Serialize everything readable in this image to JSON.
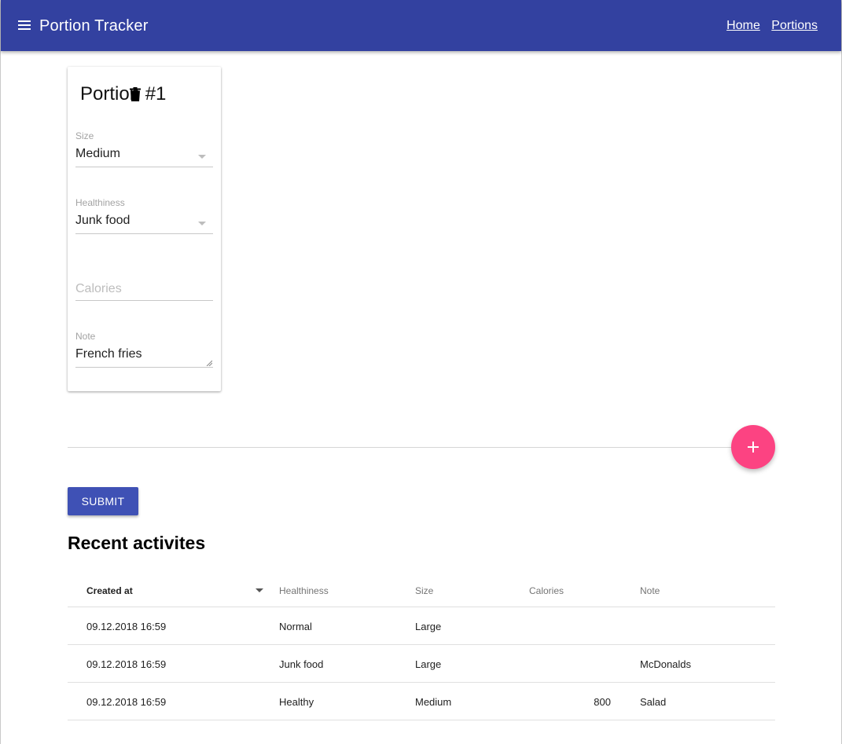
{
  "app": {
    "title": "Portion Tracker",
    "nav": {
      "home": "Home",
      "portions": "Portions"
    },
    "colors": {
      "primary": "#3341a0",
      "accent": "#fc4382",
      "button": "#3f51b5"
    }
  },
  "portion_card": {
    "title": "Portion #1",
    "size": {
      "label": "Size",
      "value": "Medium"
    },
    "healthiness": {
      "label": "Healthiness",
      "value": "Junk food"
    },
    "calories": {
      "placeholder": "Calories",
      "value": ""
    },
    "note": {
      "label": "Note",
      "value": "French fries"
    }
  },
  "actions": {
    "add_icon": "plus-icon",
    "submit_label": "SUBMIT"
  },
  "recent": {
    "title": "Recent activites",
    "columns": [
      "Created at",
      "Healthiness",
      "Size",
      "Calories",
      "Note"
    ],
    "sort_column": "Created at",
    "rows": [
      {
        "created_at": "09.12.2018 16:59",
        "healthiness": "Normal",
        "size": "Large",
        "calories": "",
        "note": ""
      },
      {
        "created_at": "09.12.2018 16:59",
        "healthiness": "Junk food",
        "size": "Large",
        "calories": "",
        "note": "McDonalds"
      },
      {
        "created_at": "09.12.2018 16:59",
        "healthiness": "Healthy",
        "size": "Medium",
        "calories": "800",
        "note": "Salad"
      }
    ]
  }
}
